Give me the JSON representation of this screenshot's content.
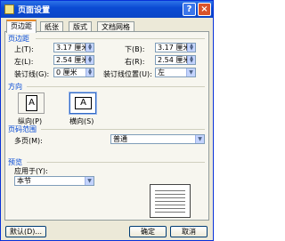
{
  "window": {
    "title": "页面设置",
    "help_glyph": "?",
    "close_glyph": "×"
  },
  "tabs": [
    "页边距",
    "纸张",
    "版式",
    "文档网格"
  ],
  "margins": {
    "section_title": "页边距",
    "top": {
      "label": "上(T):",
      "value": "3.17 厘米"
    },
    "bottom": {
      "label": "下(B):",
      "value": "3.17 厘米"
    },
    "left": {
      "label": "左(L):",
      "value": "2.54 厘米"
    },
    "right": {
      "label": "右(R):",
      "value": "2.54 厘米"
    },
    "gutter": {
      "label": "装订线(G):",
      "value": "0 厘米"
    },
    "gutter_pos": {
      "label": "装订线位置(U):",
      "value": "左"
    }
  },
  "orientation": {
    "section_title": "方向",
    "portrait_label": "纵向(P)",
    "landscape_label": "横向(S)",
    "glyph": "A",
    "selected": "landscape"
  },
  "pages": {
    "section_title": "页码范围",
    "multiple_label": "多页(M):",
    "multiple_value": "普通"
  },
  "preview": {
    "section_title": "预览",
    "apply_label": "应用于(Y):",
    "apply_value": "本节"
  },
  "buttons": {
    "default": "默认(D)...",
    "ok": "确定",
    "cancel": "取消"
  },
  "icons": {
    "spin_up": "▲",
    "spin_down": "▼",
    "dropdown": "▼"
  }
}
